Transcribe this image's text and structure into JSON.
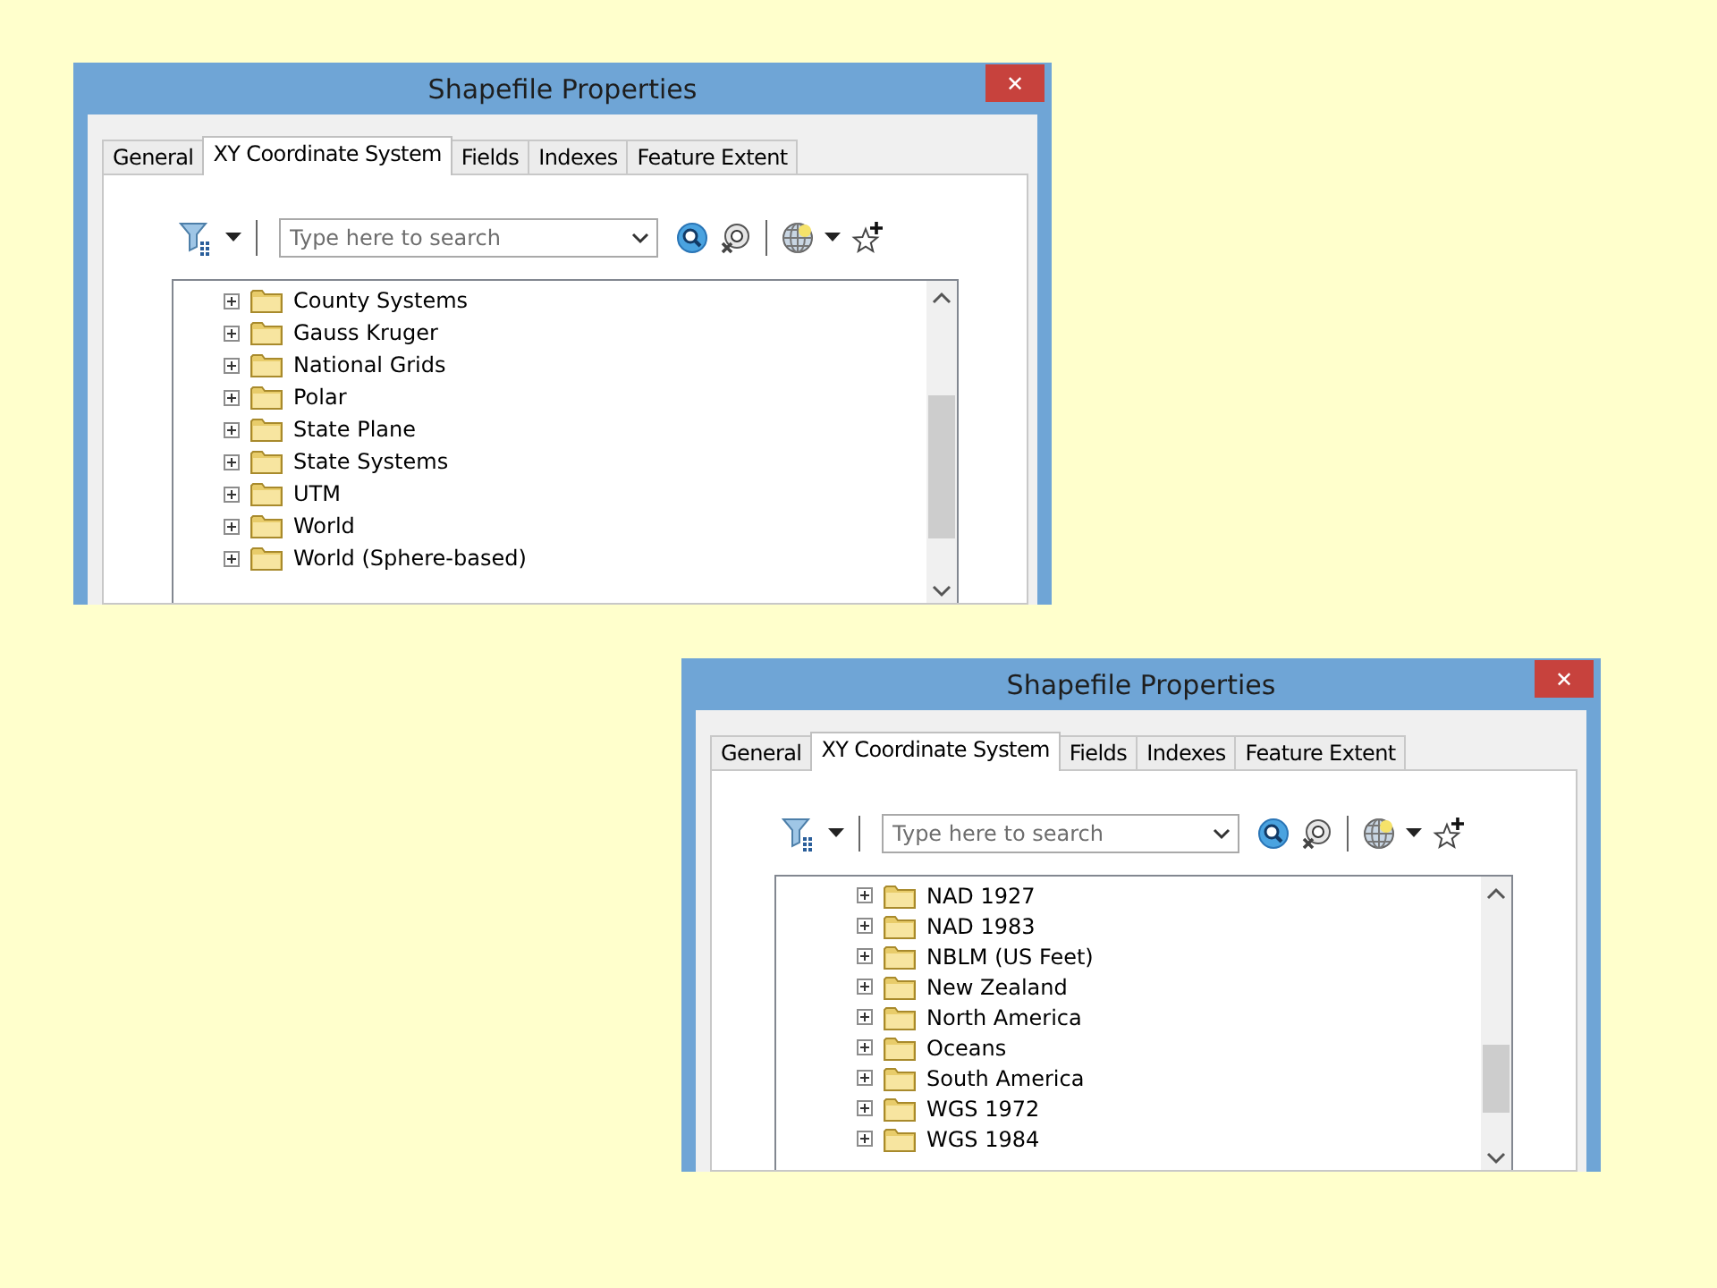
{
  "windows": [
    {
      "title": "Shapefile Properties",
      "close": "✕",
      "tabs": [
        {
          "label": "General",
          "selected": false
        },
        {
          "label": "XY Coordinate System",
          "selected": true
        },
        {
          "label": "Fields",
          "selected": false
        },
        {
          "label": "Indexes",
          "selected": false
        },
        {
          "label": "Feature Extent",
          "selected": false
        }
      ],
      "search": {
        "placeholder": "Type here to search"
      },
      "tree_items": [
        {
          "label": "County Systems",
          "expanded": false
        },
        {
          "label": "Gauss Kruger",
          "expanded": false
        },
        {
          "label": "National Grids",
          "expanded": false
        },
        {
          "label": "Polar",
          "expanded": false
        },
        {
          "label": "State Plane",
          "expanded": false
        },
        {
          "label": "State Systems",
          "expanded": false
        },
        {
          "label": "UTM",
          "expanded": false
        },
        {
          "label": "World",
          "expanded": false
        },
        {
          "label": "World (Sphere-based)",
          "expanded": false
        }
      ]
    },
    {
      "title": "Shapefile Properties",
      "close": "✕",
      "tabs": [
        {
          "label": "General",
          "selected": false
        },
        {
          "label": "XY Coordinate System",
          "selected": true
        },
        {
          "label": "Fields",
          "selected": false
        },
        {
          "label": "Indexes",
          "selected": false
        },
        {
          "label": "Feature Extent",
          "selected": false
        }
      ],
      "search": {
        "placeholder": "Type here to search"
      },
      "tree_items": [
        {
          "label": "NAD 1927",
          "expanded": false
        },
        {
          "label": "NAD 1983",
          "expanded": false
        },
        {
          "label": "NBLM (US Feet)",
          "expanded": false
        },
        {
          "label": "New Zealand",
          "expanded": false
        },
        {
          "label": "North America",
          "expanded": false
        },
        {
          "label": "Oceans",
          "expanded": false
        },
        {
          "label": "South America",
          "expanded": false
        },
        {
          "label": "WGS 1972",
          "expanded": false
        },
        {
          "label": "WGS 1984",
          "expanded": false
        }
      ]
    }
  ]
}
